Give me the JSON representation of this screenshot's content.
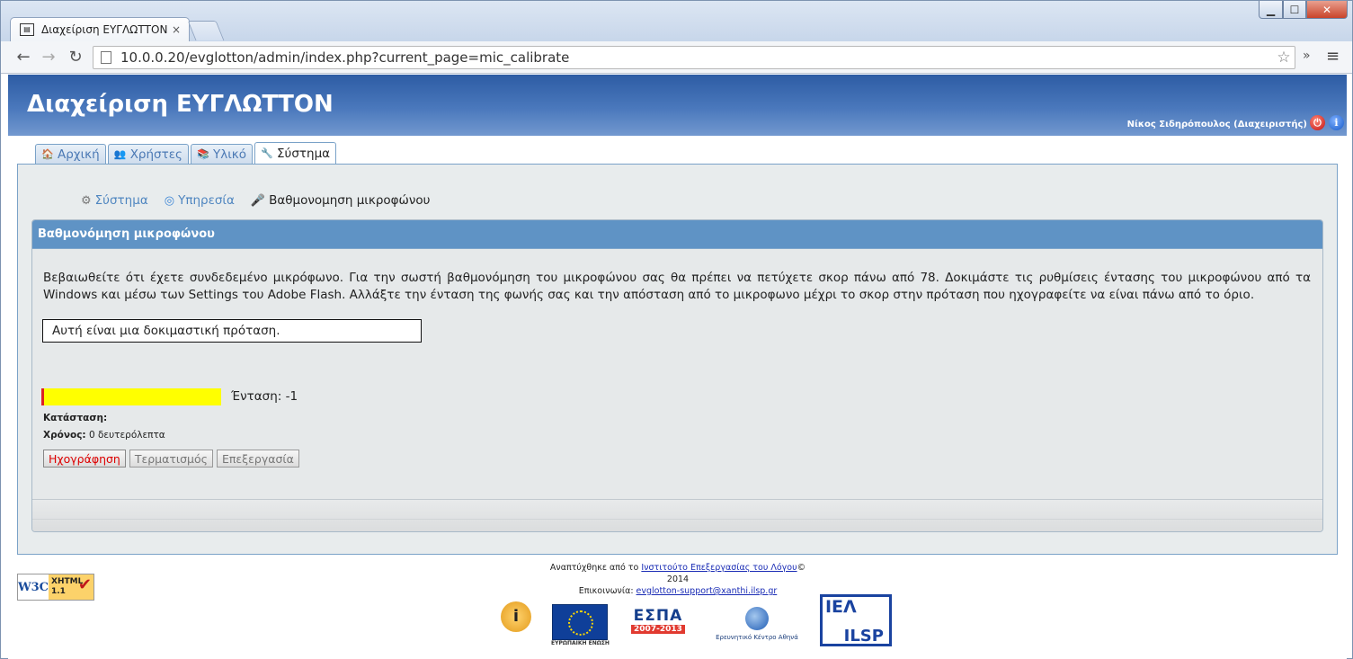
{
  "browser": {
    "tab_title": "Διαχείριση ΕΥΓΛΩΤΤΟΝ",
    "tab_close": "×",
    "url": "10.0.0.20/evglotton/admin/index.php?current_page=mic_calibrate",
    "back": "←",
    "forward": "→",
    "reload": "↻",
    "bookmark": "☆",
    "extensions": "»",
    "menu": "≡",
    "min": "▁",
    "max": "☐",
    "close": "✕"
  },
  "header": {
    "title": "Διαχείριση ΕΥΓΛΩΤΤΟΝ",
    "user": "Νίκος Σιδηρόπουλος (Διαχειριστής)",
    "power": "⏻",
    "info": "i"
  },
  "tabs": [
    {
      "label": "Αρχική",
      "icon": "🏠"
    },
    {
      "label": "Χρήστες",
      "icon": "👥"
    },
    {
      "label": "Υλικό",
      "icon": "📚"
    },
    {
      "label": "Σύστημα",
      "icon": "🔧"
    }
  ],
  "breadcrumb": {
    "system": "Σύστημα",
    "service": "Υπηρεσία",
    "current": "Βαθμονομηση μικροφώνου",
    "gear": "⚙",
    "globe": "◎",
    "mic": "🎤"
  },
  "box": {
    "title": "Βαθμονόμηση μικροφώνου",
    "instructions": "Βεβαιωθείτε ότι έχετε συνδεδεμένο μικρόφωνο. Για την σωστή βαθμονόμηση του μικροφώνου σας θα πρέπει να πετύχετε σκορ πάνω από 78. Δοκιμάστε τις ρυθμίσεις έντασης του μικροφώνου από τα Windows και μέσω των Settings του Adobe Flash. Αλλάξτε την ένταση της φωνής σας και την απόσταση από το μικροφωνο μέχρι το σκορ στην πρόταση που ηχογραφείτε να είναι πάνω από το όριο.",
    "sentence": "Αυτή είναι μια δοκιμαστική πρόταση.",
    "volume_label": "Ένταση: -1",
    "status_label": "Κατάσταση:",
    "time_label": "Χρόνος:",
    "time_value": "0 δευτερόλεπτα",
    "buttons": {
      "record": "Ηχογράφηση",
      "stop": "Τερματισμός",
      "process": "Επεξεργασία"
    }
  },
  "footer": {
    "dev_prefix": "Αναπτύχθηκε από το ",
    "dev_link": "Ινστιτούτο Επεξεργασίας του Λόγου",
    "dev_suffix": "© 2014",
    "contact_prefix": "Επικοινωνία: ",
    "contact_link": "evglotton-support@xanthi.ilsp.gr",
    "w3c_mark": "W3C",
    "w3c_xhtml": "XHTML",
    "w3c_ver": "1.1",
    "logos": {
      "eu_caption": "ΕΥΡΩΠΑΪΚΗ ΕΝΩΣΗ",
      "espa_title": "ΕΣΠΑ",
      "espa_years": "2007-2013",
      "rc_title": "Ερευνητικό Κέντρο Αθηνά",
      "ilsp_top": "ΙΕΛ",
      "ilsp_bottom": "ILSP"
    }
  },
  "colors": {
    "header_blue": "#4a78bc",
    "box_header": "#5f93c5",
    "meter": "#ffff00",
    "record_text": "#dd0000"
  }
}
